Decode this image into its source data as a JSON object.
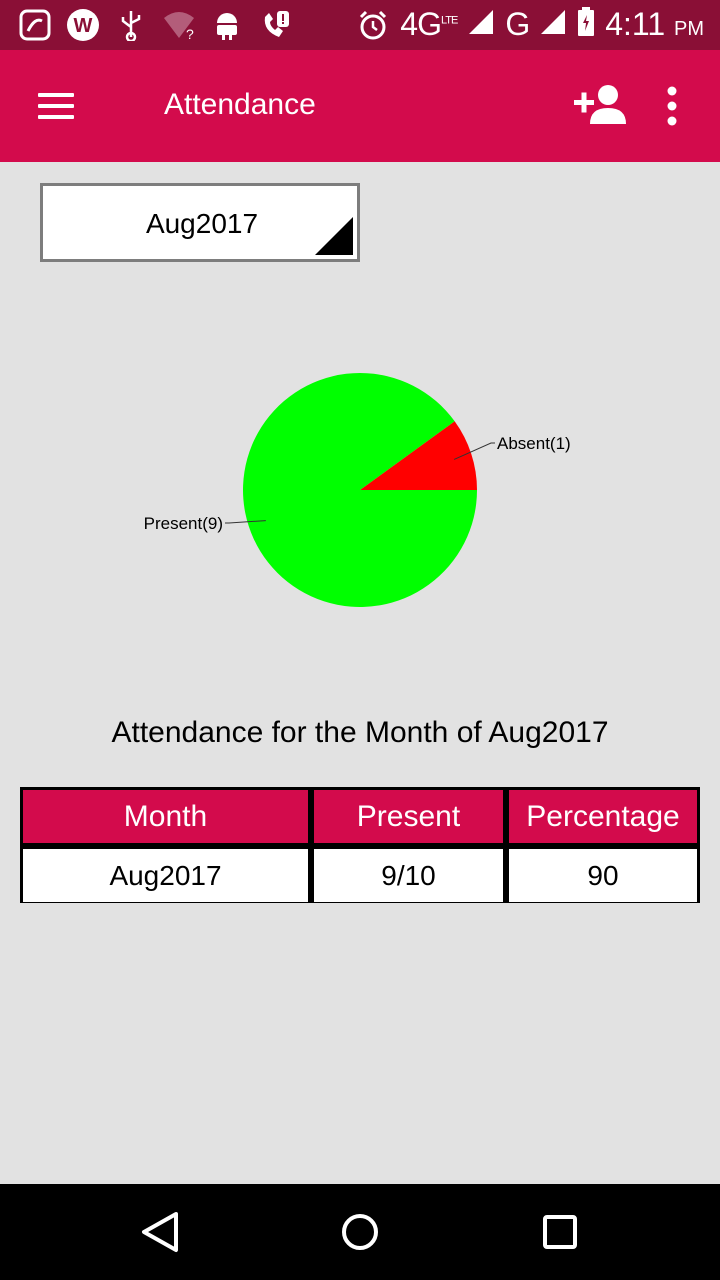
{
  "status_bar": {
    "network": "4G",
    "network_sup": "LTE",
    "network2": "G",
    "time": "4:11",
    "ampm": "PM",
    "icons": [
      "saavn-icon",
      "w-app-icon",
      "usb-icon",
      "wifi-unknown-icon",
      "android-icon",
      "missed-call-icon",
      "alarm-icon",
      "signal-icon",
      "battery-icon"
    ]
  },
  "app_bar": {
    "title": "Attendance",
    "menu_icon": "hamburger-menu-icon",
    "add_icon": "add-person-icon",
    "more_icon": "more-vertical-icon"
  },
  "month_select": {
    "value": "Aug2017"
  },
  "chart_data": {
    "type": "pie",
    "slices": [
      {
        "label": "Present(9)",
        "value": 9,
        "color": "#00ff00"
      },
      {
        "label": "Absent(1)",
        "value": 1,
        "color": "#ff0000"
      }
    ]
  },
  "summary": {
    "title": "Attendance for the Month of Aug2017"
  },
  "table": {
    "headers": [
      "Month",
      "Present",
      "Percentage"
    ],
    "rows": [
      [
        "Aug2017",
        "9/10",
        "90"
      ]
    ]
  },
  "colors": {
    "accent": "#d30b4c",
    "status_bar": "#8a0f36",
    "background": "#e2e2e2"
  },
  "nav_bar": {
    "icons": [
      "back-icon",
      "home-icon",
      "recents-icon"
    ]
  }
}
